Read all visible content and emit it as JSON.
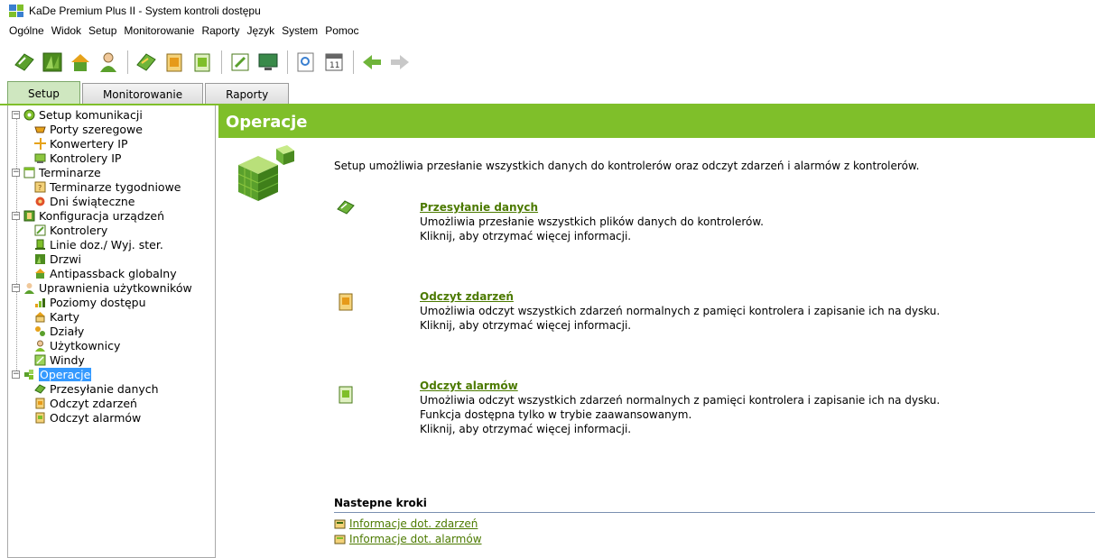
{
  "window": {
    "title": "KaDe Premium Plus II - System kontroli dostępu"
  },
  "menu": [
    "Ogólne",
    "Widok",
    "Setup",
    "Monitorowanie",
    "Raporty",
    "Język",
    "System",
    "Pomoc"
  ],
  "tabs": [
    {
      "label": "Setup",
      "active": true
    },
    {
      "label": "Monitorowanie",
      "active": false
    },
    {
      "label": "Raporty",
      "active": false
    }
  ],
  "tree": {
    "groups": [
      {
        "label": "Setup komunikacji",
        "icon": "globe-icon",
        "items": [
          {
            "label": "Porty szeregowe",
            "icon": "serial-port-icon"
          },
          {
            "label": "Konwertery IP",
            "icon": "ip-converter-icon"
          },
          {
            "label": "Kontrolery IP",
            "icon": "ip-controller-icon"
          }
        ]
      },
      {
        "label": "Terminarze",
        "icon": "calendar-icon",
        "items": [
          {
            "label": "Terminarze tygodniowe",
            "icon": "weekly-schedule-icon"
          },
          {
            "label": "Dni świąteczne",
            "icon": "holiday-icon"
          }
        ]
      },
      {
        "label": "Konfiguracja urządzeń",
        "icon": "device-config-icon",
        "items": [
          {
            "label": "Kontrolery",
            "icon": "controller-icon"
          },
          {
            "label": "Linie doz./ Wyj. ster.",
            "icon": "lines-icon"
          },
          {
            "label": "Drzwi",
            "icon": "door-icon"
          },
          {
            "label": "Antipassback globalny",
            "icon": "antipassback-icon"
          }
        ]
      },
      {
        "label": "Uprawnienia użytkowników",
        "icon": "users-icon",
        "items": [
          {
            "label": "Poziomy dostępu",
            "icon": "access-level-icon"
          },
          {
            "label": "Karty",
            "icon": "card-icon"
          },
          {
            "label": "Działy",
            "icon": "department-icon"
          },
          {
            "label": "Użytkownicy",
            "icon": "user-icon"
          },
          {
            "label": "Windy",
            "icon": "elevator-icon"
          }
        ]
      },
      {
        "label": "Operacje",
        "icon": "operations-icon",
        "selected": true,
        "items": [
          {
            "label": "Przesyłanie danych",
            "icon": "data-transfer-icon"
          },
          {
            "label": "Odczyt zdarzeń",
            "icon": "events-read-icon"
          },
          {
            "label": "Odczyt alarmów",
            "icon": "alarms-read-icon"
          }
        ]
      }
    ]
  },
  "content": {
    "header": "Operacje",
    "intro": "Setup umożliwia przesłanie wszystkich danych do kontrolerów oraz odczyt zdarzeń i alarmów z kontrolerów.",
    "sections": [
      {
        "title": "Przesyłanie danych",
        "lines": [
          "Umożliwia przesłanie wszystkich plików danych do kontrolerów.",
          "Kliknij, aby otrzymać więcej informacji."
        ]
      },
      {
        "title": "Odczyt zdarzeń",
        "lines": [
          "Umożliwia odczyt wszystkich zdarzeń normalnych z pamięci kontrolera i zapisanie ich na dysku.",
          "Kliknij, aby otrzymać więcej informacji."
        ]
      },
      {
        "title": "Odczyt alarmów",
        "lines": [
          "Umożliwia odczyt wszystkich zdarzeń normalnych z pamięci kontrolera i zapisanie ich na dysku.",
          "Funkcja dostępna tylko w trybie zaawansowanym.",
          "Kliknij, aby otrzymać więcej informacji."
        ]
      }
    ],
    "next_steps": {
      "title": "Nastepne kroki",
      "links": [
        "Informacje dot. zdarzeń",
        "Informacje dot. alarmów"
      ]
    }
  },
  "colors": {
    "accent": "#7fbf2a",
    "link": "#4c7a00",
    "selection": "#3399ff"
  }
}
